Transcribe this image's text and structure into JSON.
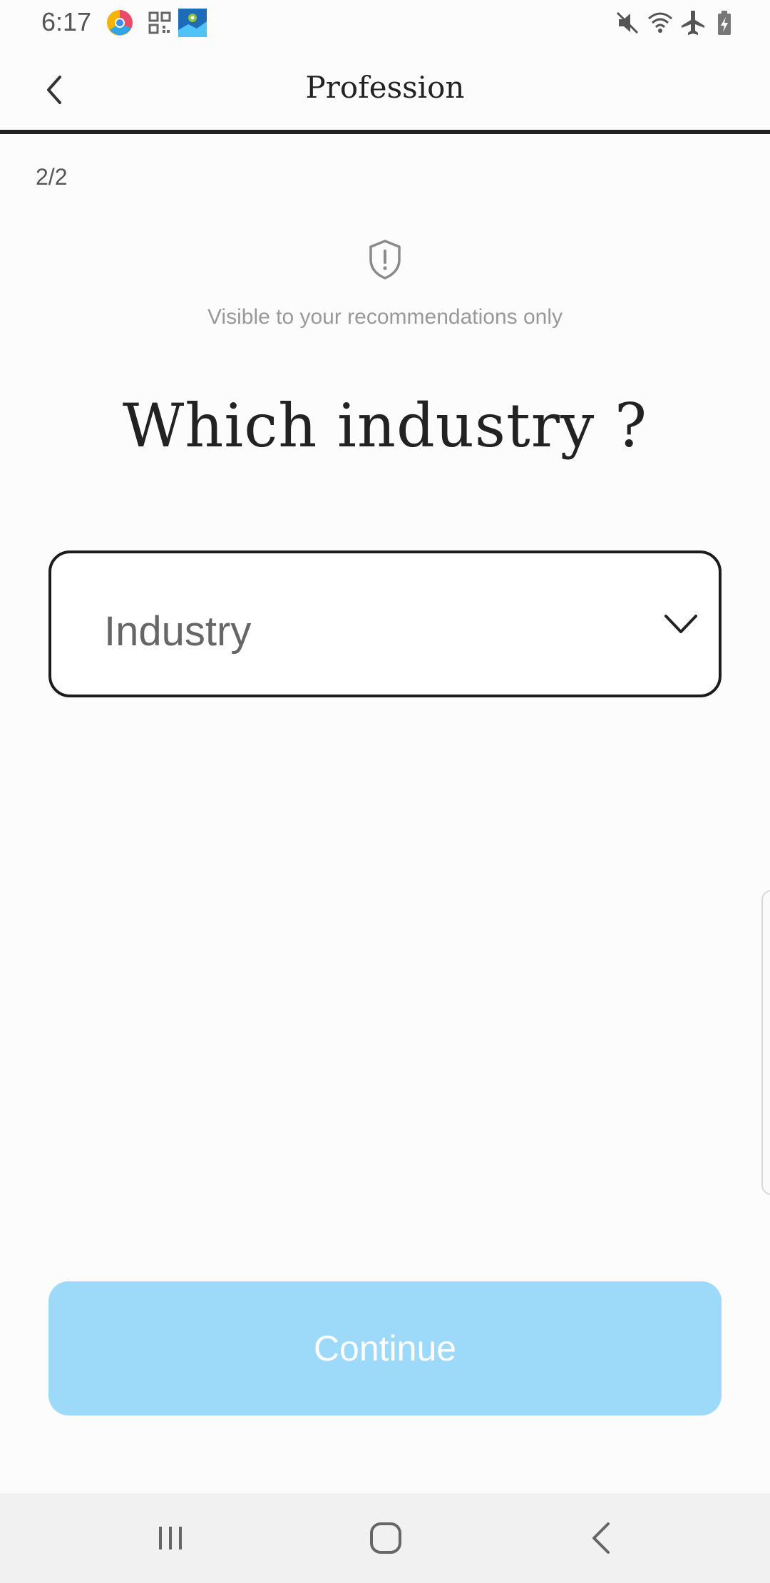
{
  "status_bar": {
    "time": "6:17",
    "left_icons": [
      "chrome-like-app-icon",
      "qr-code-icon",
      "maps-app-icon"
    ],
    "right_icons": [
      "mute-icon",
      "wifi-icon",
      "airplane-mode-icon",
      "battery-charging-icon"
    ]
  },
  "header": {
    "title": "Profession",
    "back_icon": "chevron-left-icon"
  },
  "step_indicator": "2/2",
  "privacy": {
    "icon": "shield-alert-icon",
    "note": "Visible to your recommendations only"
  },
  "question": "Which industry ?",
  "industry_select": {
    "placeholder": "Industry",
    "icon": "chevron-down-icon"
  },
  "continue_button": {
    "label": "Continue",
    "color": "#9dd9f9",
    "enabled": false
  },
  "nav_bar": {
    "buttons": [
      "recent-apps-icon",
      "home-icon",
      "back-icon"
    ]
  }
}
